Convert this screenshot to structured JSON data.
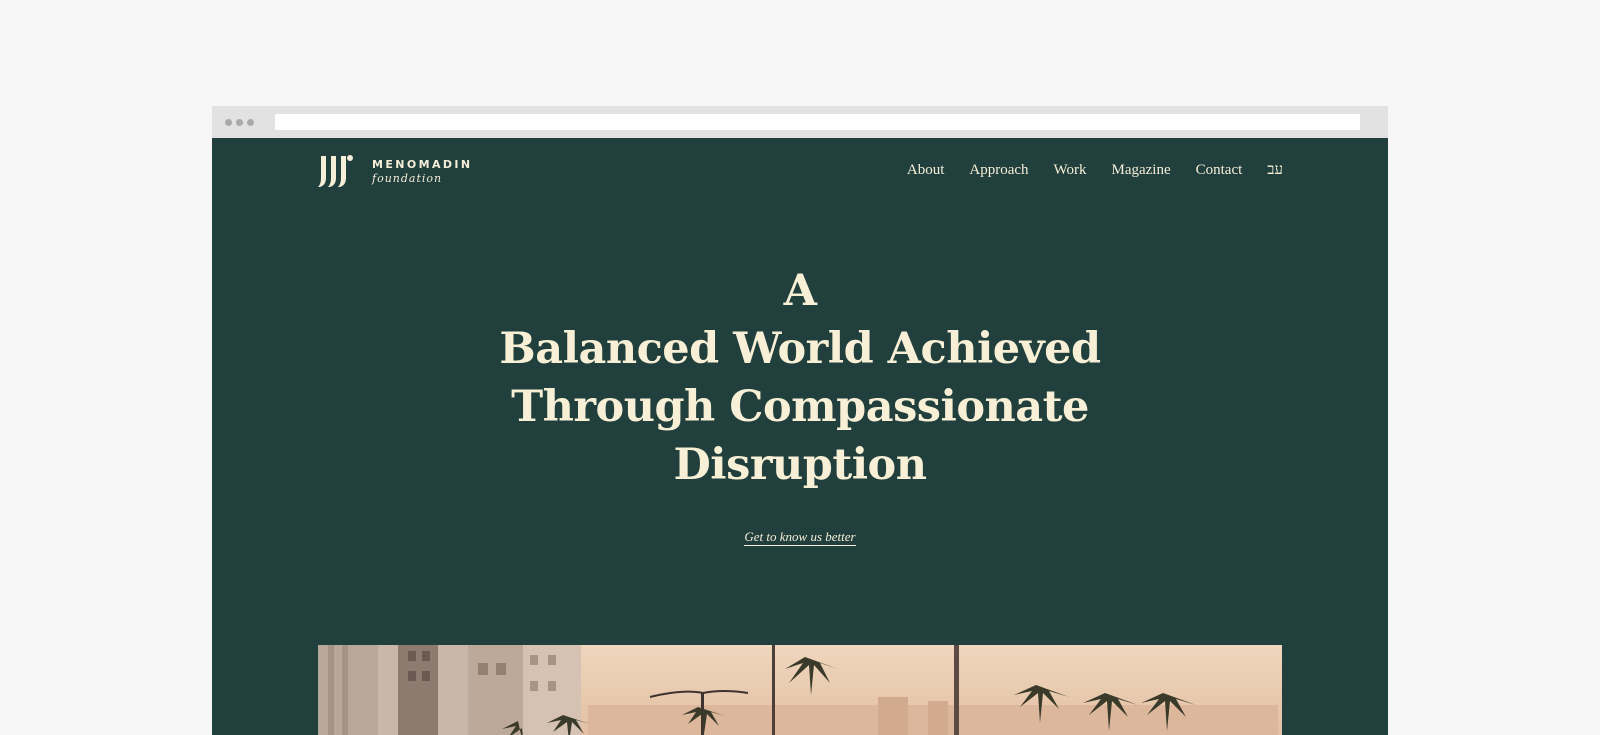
{
  "brand": {
    "name": "MENOMADIN",
    "sub": "foundation"
  },
  "nav": {
    "items": [
      {
        "label": "About"
      },
      {
        "label": "Approach"
      },
      {
        "label": "Work"
      },
      {
        "label": "Magazine"
      },
      {
        "label": "Contact"
      },
      {
        "label": "עב"
      }
    ]
  },
  "hero": {
    "lines": [
      "A",
      "Balanced World Achieved",
      "Through Compassionate",
      "Disruption"
    ],
    "cta": "Get to know us better"
  },
  "colors": {
    "background": "#213f3c",
    "text": "#f5eed8",
    "page_bg": "#f6f6f6",
    "browser_chrome": "#e2e2e2"
  }
}
